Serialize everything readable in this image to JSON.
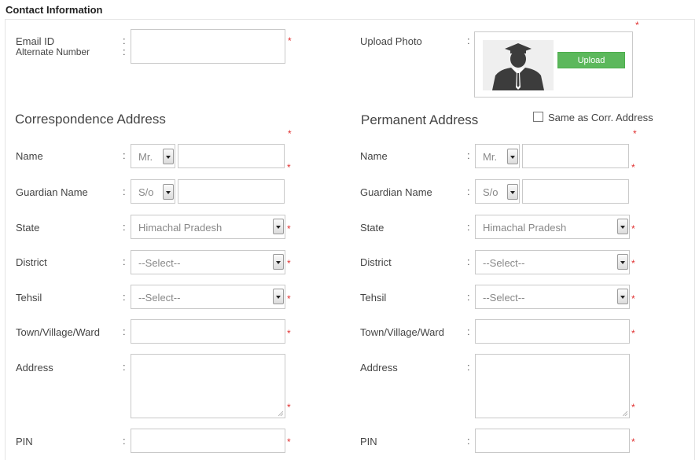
{
  "section_title": "Contact Information",
  "colon": ":",
  "required_mark": "*",
  "contact": {
    "email_label": "Email ID",
    "alternate_label": "Alternate Number",
    "upload_photo_label": "Upload Photo",
    "upload_button": "Upload"
  },
  "correspondence": {
    "heading": "Correspondence Address",
    "name_label": "Name",
    "salutation": "Mr.",
    "guardian_label": "Guardian Name",
    "relation": "S/o",
    "state_label": "State",
    "state_value": "Himachal Pradesh",
    "district_label": "District",
    "district_value": "--Select--",
    "tehsil_label": "Tehsil",
    "tehsil_value": "--Select--",
    "town_label": "Town/Village/Ward",
    "address_label": "Address",
    "pin_label": "PIN"
  },
  "permanent": {
    "heading": "Permanent Address",
    "same_as_label": "Same as Corr. Address",
    "name_label": "Name",
    "salutation": "Mr.",
    "guardian_label": "Guardian Name",
    "relation": "S/o",
    "state_label": "State",
    "state_value": "Himachal Pradesh",
    "district_label": "District",
    "district_value": "--Select--",
    "tehsil_label": "Tehsil",
    "tehsil_value": "--Select--",
    "town_label": "Town/Village/Ward",
    "address_label": "Address",
    "pin_label": "PIN"
  },
  "colors": {
    "required": "#e03030",
    "upload_button": "#5cb85c",
    "border": "#c9c9c9"
  },
  "icons": {
    "avatar": "person-silhouette-icon",
    "dropdown": "chevron-down-icon"
  }
}
